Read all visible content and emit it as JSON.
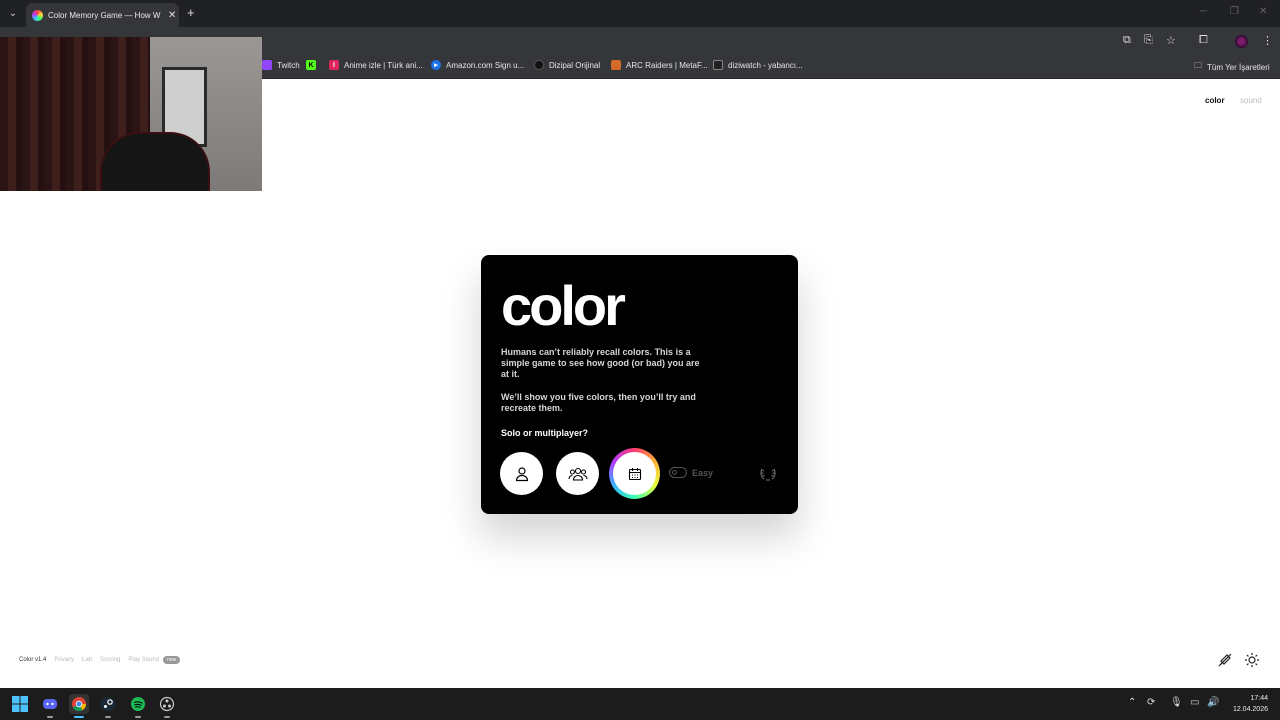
{
  "browser": {
    "tab_title": "Color Memory Game — How W",
    "new_tab": "+",
    "bookmarks": [
      {
        "label": "Twitch",
        "icon": "twitch-icon",
        "color": "#9146ff"
      },
      {
        "label": "",
        "icon": "kick-icon",
        "color": "#53fc18"
      },
      {
        "label": "Anime izle | Türk ani...",
        "icon": "anime-icon",
        "color": "#e0245e"
      },
      {
        "label": "Amazon.com Sign u...",
        "icon": "amazon-icon",
        "color": "#1a73e8"
      },
      {
        "label": "Dizipal Orijinal",
        "icon": "dizipal-icon",
        "color": "#111111"
      },
      {
        "label": "ARC Raiders | MetaF...",
        "icon": "arc-icon",
        "color": "#d46a2a"
      },
      {
        "label": "diziwatch - yabancı...",
        "icon": "diziwatch-icon",
        "color": "#222222"
      }
    ],
    "all_bookmarks": "Tüm Yer İşaretleri"
  },
  "page": {
    "nav": {
      "color": "color",
      "sound": "sound"
    },
    "card": {
      "title": "color",
      "p1": "Humans can’t reliably recall colors. This is a simple game to see how good (or bad) you are at it.",
      "p2": "We’ll show you five colors, then you’ll try and recreate them.",
      "question": "Solo or multiplayer?",
      "mode_label": "Easy"
    },
    "footer": {
      "brand": "Color v1.4",
      "privacy": "Privacy",
      "lab": "Lab",
      "scoring": "Scoring",
      "play_sound": "Play Sound",
      "new_badge": "new"
    }
  },
  "taskbar": {
    "time": "17:44",
    "date": "12.04.2026"
  }
}
